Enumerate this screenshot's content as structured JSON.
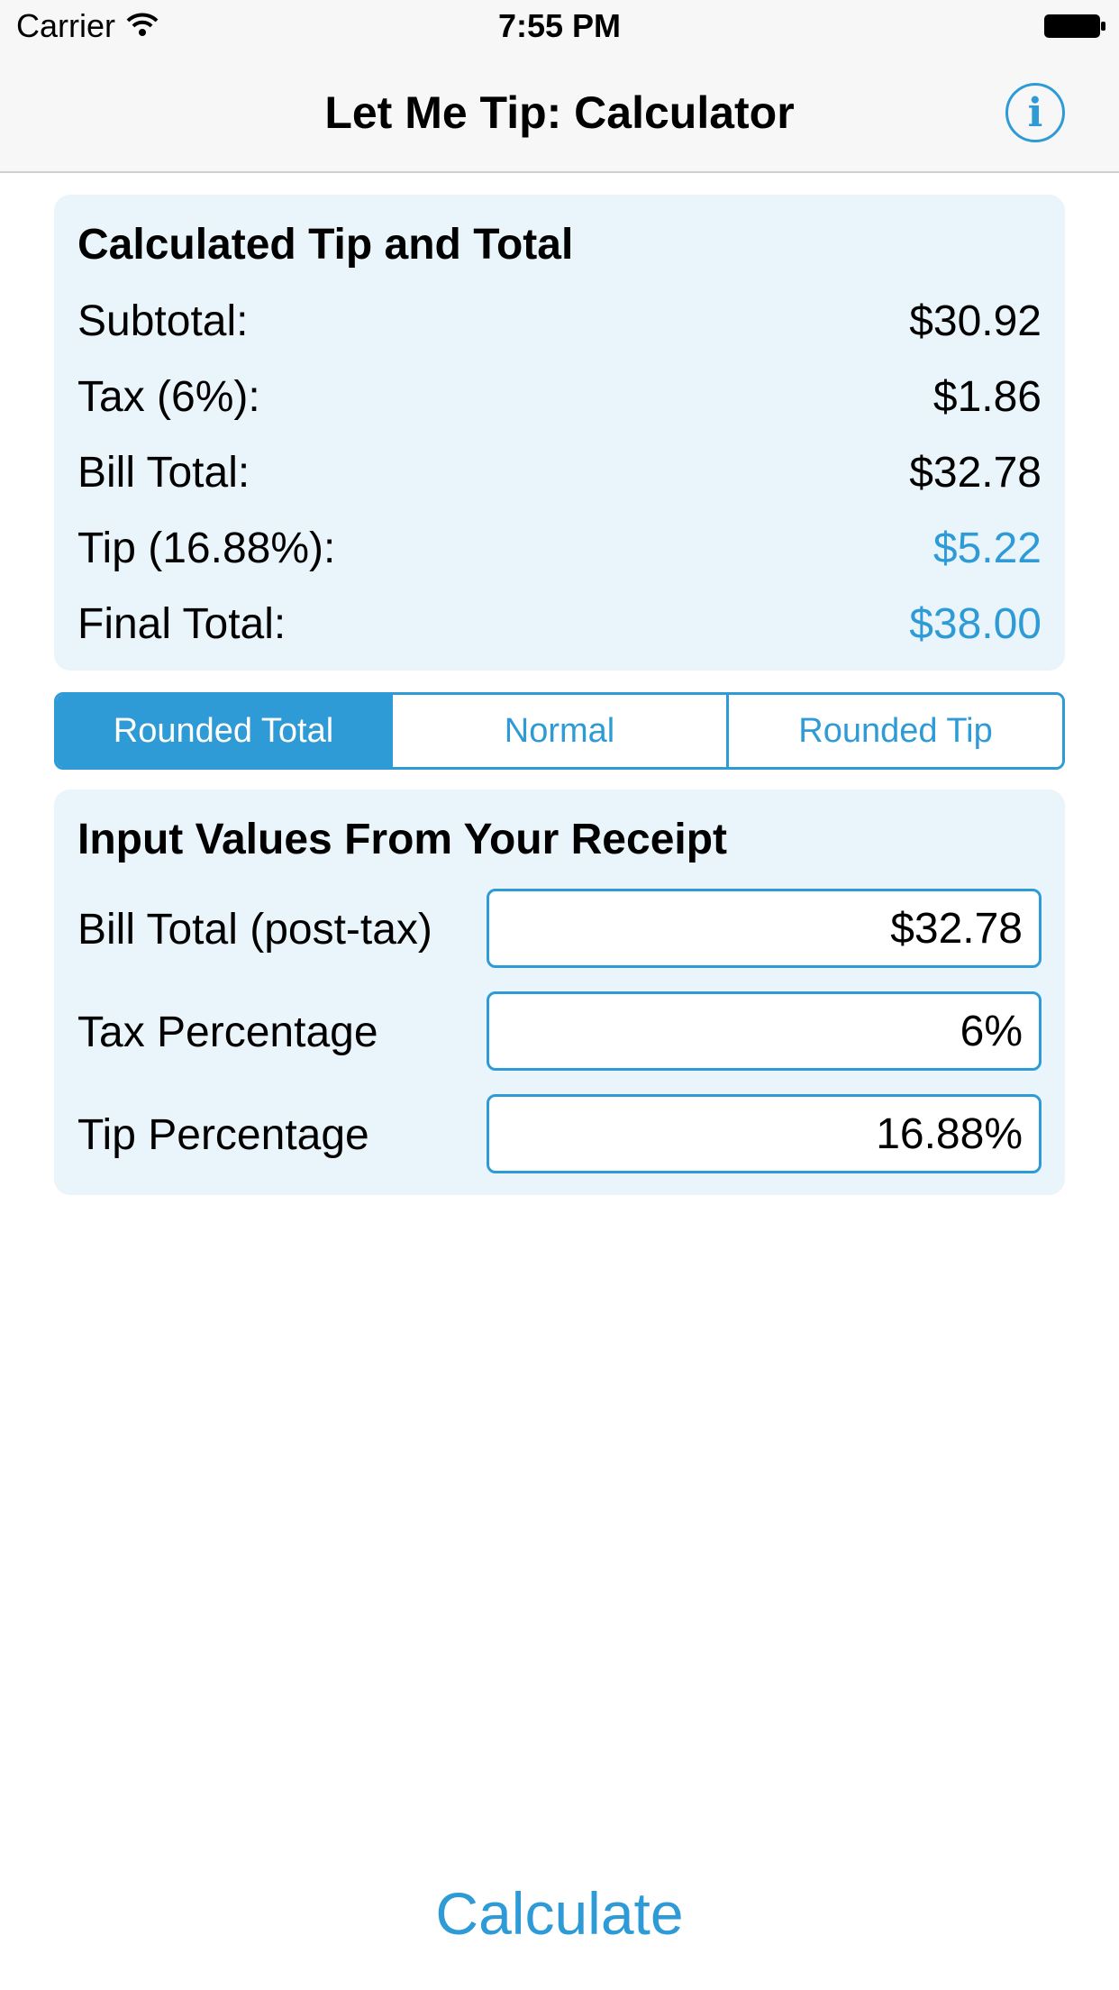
{
  "status_bar": {
    "carrier": "Carrier",
    "time": "7:55 PM"
  },
  "nav": {
    "title": "Let Me Tip: Calculator",
    "info_icon": "info-icon"
  },
  "results": {
    "title": "Calculated Tip and Total",
    "rows": [
      {
        "label": "Subtotal:",
        "value": "$30.92"
      },
      {
        "label": "Tax (6%):",
        "value": "$1.86"
      },
      {
        "label": "Bill Total:",
        "value": "$32.78"
      },
      {
        "label": "Tip (16.88%):",
        "value": "$5.22"
      },
      {
        "label": "Final Total:",
        "value": "$38.00"
      }
    ]
  },
  "mode_selector": {
    "options": [
      "Rounded Total",
      "Normal",
      "Rounded Tip"
    ],
    "selected": "Rounded Total"
  },
  "inputs": {
    "title": "Input Values From Your Receipt",
    "fields": [
      {
        "label": "Bill Total (post-tax)",
        "value": "$32.78"
      },
      {
        "label": "Tax Percentage",
        "value": "6%"
      },
      {
        "label": "Tip Percentage",
        "value": "16.88%"
      }
    ]
  },
  "actions": {
    "calculate_label": "Calculate"
  },
  "colors": {
    "accent": "#2e9bd6",
    "panel_background": "#eaf4fb"
  }
}
